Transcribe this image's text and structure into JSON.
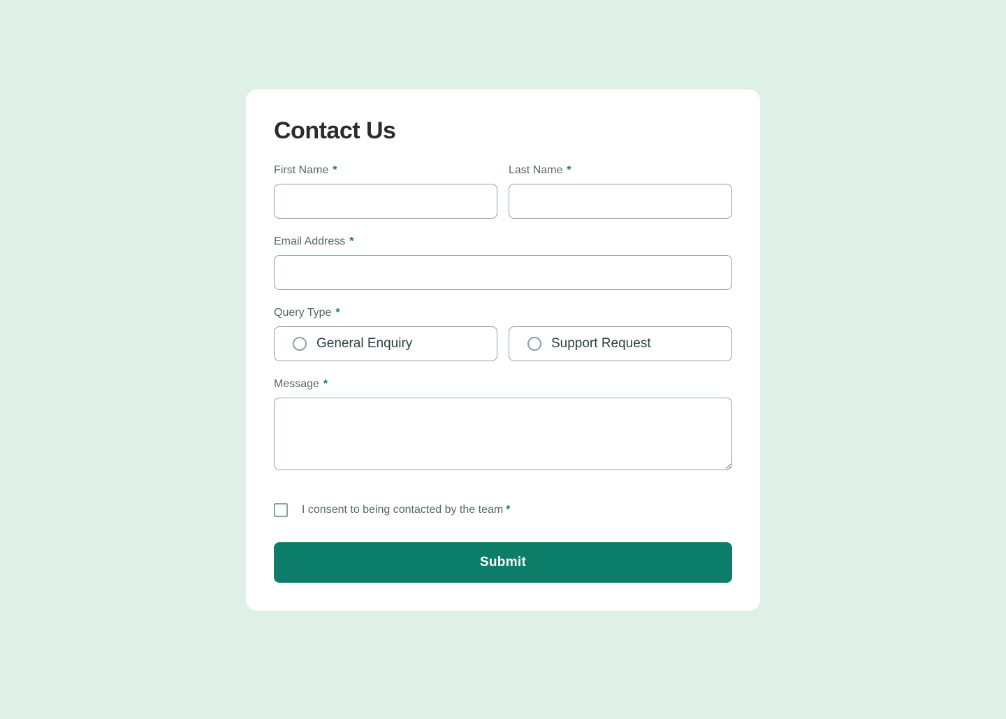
{
  "form": {
    "title": "Contact Us",
    "required_mark": "*",
    "first_name": {
      "label": "First Name",
      "value": ""
    },
    "last_name": {
      "label": "Last Name",
      "value": ""
    },
    "email": {
      "label": "Email Address",
      "value": ""
    },
    "query_type": {
      "label": "Query Type",
      "options": [
        {
          "value": "general",
          "label": "General Enquiry"
        },
        {
          "value": "support",
          "label": "Support Request"
        }
      ],
      "selected": ""
    },
    "message": {
      "label": "Message",
      "value": ""
    },
    "consent": {
      "label": "I consent to being contacted by the team",
      "checked": false
    },
    "submit_label": "Submit"
  },
  "colors": {
    "background": "#dff1e7",
    "accent": "#0c7d69",
    "card": "#ffffff",
    "border": "#87a3a6"
  }
}
